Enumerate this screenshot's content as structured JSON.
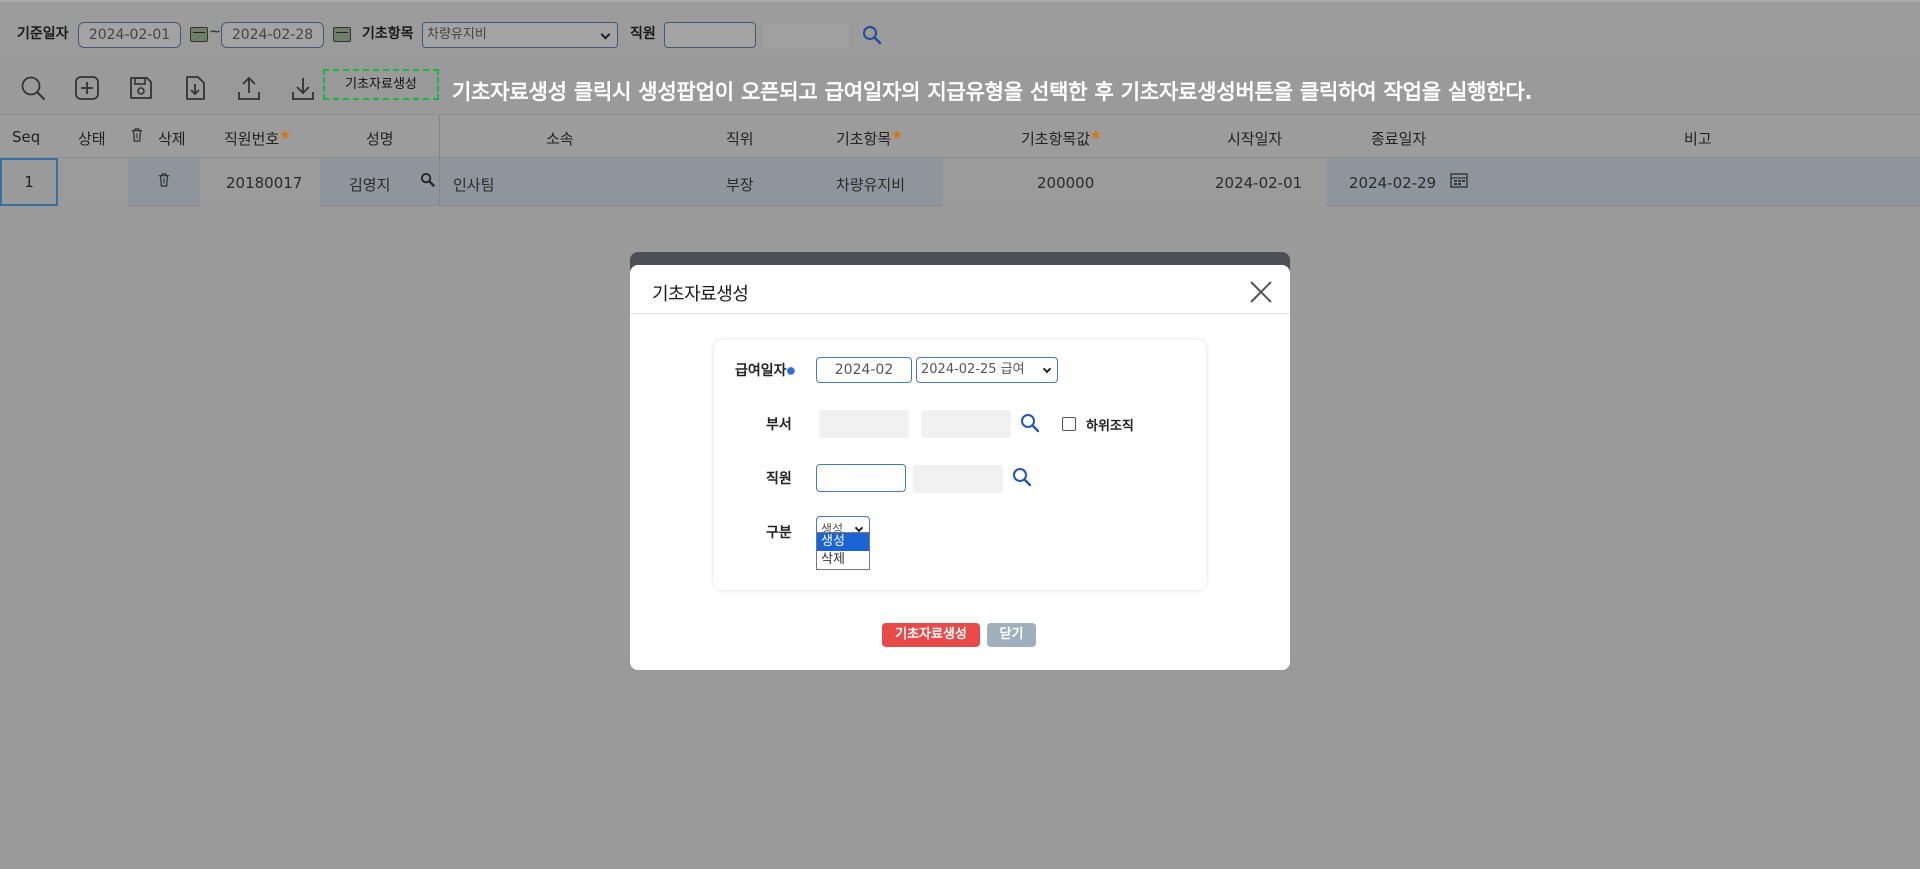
{
  "search": {
    "date_label": "기준일자",
    "date_from": "2024-02-01",
    "date_sep": "~",
    "date_to": "2024-02-28",
    "item_label": "기초항목",
    "item_value": "차량유지비",
    "employee_label": "직원",
    "employee_value": ""
  },
  "toolbar": {
    "icons": [
      "search-icon",
      "add-icon",
      "save-icon",
      "import-icon",
      "upload-icon",
      "download-icon"
    ],
    "base_data_button": "기초자료생성",
    "instruction": "기초자료생성 클릭시 생성팝업이 오픈되고 급여일자의 지급유형을 선택한 후 기초자료생성버튼을 클릭하여 작업을 실행한다."
  },
  "grid": {
    "headers": {
      "seq": "Seq",
      "status": "상태",
      "delete": "삭제",
      "emp_no": "직원번호",
      "name": "성명",
      "dept": "소속",
      "position": "직위",
      "base_item": "기초항목",
      "base_value": "기초항목값",
      "start_date": "시작일자",
      "end_date": "종료일자",
      "note": "비고"
    },
    "rows": [
      {
        "seq": "1",
        "status": "",
        "emp_no": "20180017",
        "name": "김영지",
        "dept": "인사팀",
        "position": "부장",
        "base_item": "차량유지비",
        "base_value": "200000",
        "start_date": "2024-02-01",
        "end_date": "2024-02-29",
        "note": ""
      }
    ]
  },
  "modal": {
    "title": "기초자료생성",
    "pay_date_label": "급여일자",
    "pay_month": "2024-02",
    "pay_type": "2024-02-25 급여",
    "dept_label": "부서",
    "sub_org_label": "하위조직",
    "employee_label": "직원",
    "type_label": "구분",
    "type_value": "생성",
    "type_options": [
      "생성",
      "삭제"
    ],
    "create_button": "기초자료생성",
    "close_button": "닫기"
  },
  "colors": {
    "accent_red": "#e84a4a",
    "selection_blue": "#1a64d6",
    "dashed_highlight": "#1db544",
    "required_marker": "#d4760a"
  }
}
